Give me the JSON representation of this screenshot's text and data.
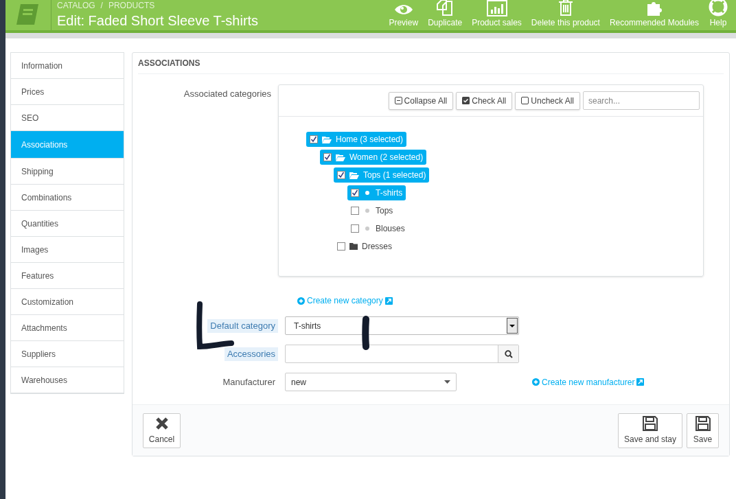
{
  "header": {
    "breadcrumb": [
      "CATALOG",
      "PRODUCTS"
    ],
    "separator": "/",
    "title": "Edit: Faded Short Sleeve T-shirts",
    "toolbar": [
      {
        "kind": "eye",
        "label": "Preview"
      },
      {
        "kind": "copy",
        "label": "Duplicate"
      },
      {
        "kind": "chart",
        "label": "Product sales"
      },
      {
        "kind": "trash",
        "label": "Delete this product"
      },
      {
        "kind": "puzzle",
        "label": "Recommended Modules"
      },
      {
        "kind": "lifebuoy",
        "label": "Help"
      }
    ]
  },
  "tabs": [
    {
      "label": "Information",
      "selected": false
    },
    {
      "label": "Prices",
      "selected": false
    },
    {
      "label": "SEO",
      "selected": false
    },
    {
      "label": "Associations",
      "selected": true
    },
    {
      "label": "Shipping",
      "selected": false
    },
    {
      "label": "Combinations",
      "selected": false
    },
    {
      "label": "Quantities",
      "selected": false
    },
    {
      "label": "Images",
      "selected": false
    },
    {
      "label": "Features",
      "selected": false
    },
    {
      "label": "Customization",
      "selected": false
    },
    {
      "label": "Attachments",
      "selected": false
    },
    {
      "label": "Suppliers",
      "selected": false
    },
    {
      "label": "Warehouses",
      "selected": false
    }
  ],
  "panel": {
    "heading": "ASSOCIATIONS",
    "categories": {
      "label": "Associated categories",
      "buttons": [
        {
          "kind": "collapse",
          "label": "Collapse All"
        },
        {
          "kind": "check",
          "label": "Check All"
        },
        {
          "kind": "uncheck",
          "label": "Uncheck All"
        }
      ],
      "search": {
        "placeholder": "search..."
      },
      "tree": [
        {
          "kind": "folder",
          "label": "Home (3 selected)",
          "checked": true,
          "selected": true,
          "expanded": true,
          "children": [
            {
              "kind": "folder",
              "label": "Women (2 selected)",
              "checked": true,
              "selected": true,
              "expanded": true,
              "children": [
                {
                  "kind": "folder",
                  "label": "Tops (1 selected)",
                  "checked": true,
                  "selected": true,
                  "expanded": true,
                  "children": [
                    {
                      "kind": "leaf",
                      "label": "T-shirts",
                      "checked": true,
                      "selected": true
                    },
                    {
                      "kind": "leaf",
                      "label": "Tops",
                      "checked": false,
                      "selected": false
                    },
                    {
                      "kind": "leaf",
                      "label": "Blouses",
                      "checked": false,
                      "selected": false
                    }
                  ]
                },
                {
                  "kind": "folder",
                  "label": "Dresses",
                  "checked": false,
                  "selected": false,
                  "expanded": false
                }
              ]
            }
          ]
        }
      ]
    },
    "create_category": "Create new category",
    "fields": [
      {
        "kind": "select",
        "label": "Default category",
        "highlighted": true,
        "value": "T-shirts"
      },
      {
        "kind": "search",
        "label": "Accessories",
        "highlighted": true
      },
      {
        "kind": "dropdown",
        "label": "Manufacturer",
        "highlighted": false,
        "value": "new",
        "link": "Create new manufacturer"
      }
    ],
    "footer": {
      "cancel": "Cancel",
      "save_and_stay": "Save and stay",
      "save": "Save"
    }
  }
}
